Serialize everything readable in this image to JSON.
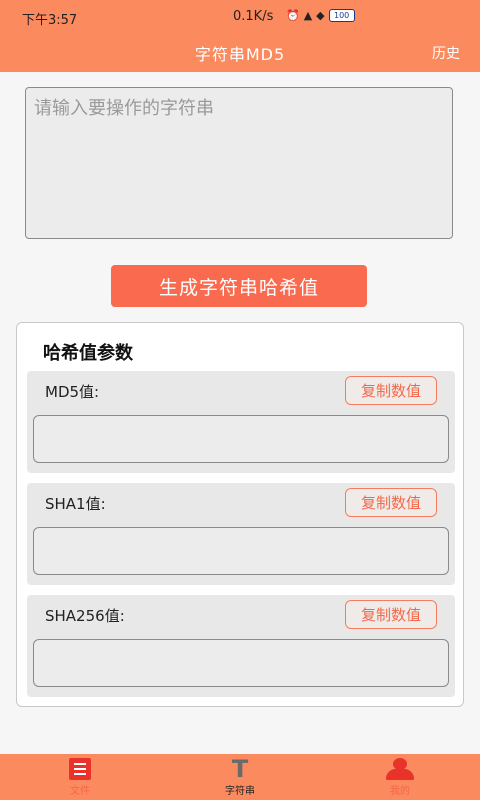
{
  "status_bar": {
    "time": "下午3:57",
    "network_speed": "0.1K/s",
    "battery": "100"
  },
  "header": {
    "title": "字符串MD5",
    "history_label": "历史"
  },
  "input": {
    "placeholder": "请输入要操作的字符串",
    "value": ""
  },
  "generate_button": "生成字符串哈希值",
  "params": {
    "title": "哈希值参数",
    "rows": [
      {
        "label": "MD5值:",
        "copy_label": "复制数值",
        "value": ""
      },
      {
        "label": "SHA1值:",
        "copy_label": "复制数值",
        "value": ""
      },
      {
        "label": "SHA256值:",
        "copy_label": "复制数值",
        "value": ""
      }
    ]
  },
  "tabs": [
    {
      "label": "文件",
      "icon": "document-icon",
      "active": false
    },
    {
      "label": "字符串",
      "icon": "text-icon",
      "active": true
    },
    {
      "label": "我的",
      "icon": "user-icon",
      "active": false
    }
  ],
  "colors": {
    "brand": "#fb8a5e",
    "button": "#fa6a4e",
    "accent_red": "#e8322a"
  }
}
